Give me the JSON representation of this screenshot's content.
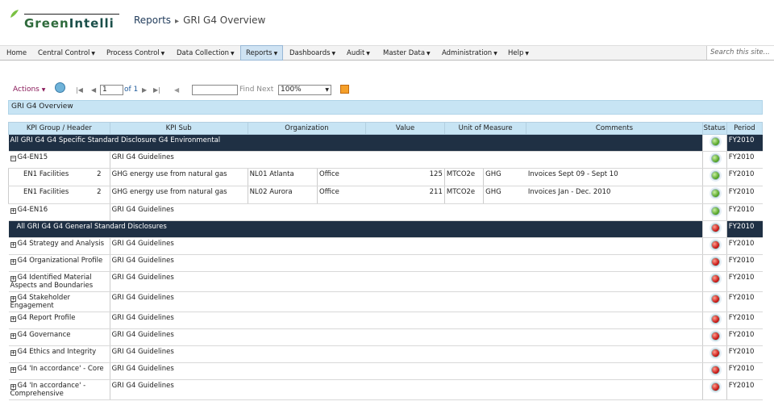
{
  "brand": {
    "name_prefix": "Green",
    "name_suffix": "Intelli"
  },
  "breadcrumb": {
    "root": "Reports",
    "current": "GRI G4 Overview"
  },
  "nav": {
    "items": [
      "Home",
      "Central Control",
      "Process Control",
      "Data Collection",
      "Reports",
      "Dashboards",
      "Audit",
      "Master Data",
      "Administration",
      "Help"
    ],
    "search_placeholder": "Search this site..."
  },
  "toolbar": {
    "actions_label": "Actions",
    "page_value": "1",
    "page_of": "of 1",
    "find_next": "Find Next",
    "zoom": "100%"
  },
  "report_title": "GRI G4 Overview",
  "columns": [
    "KPI Group / Header",
    "KPI Sub",
    "Organization",
    "Value",
    "Unit of Measure",
    "Comments",
    "Status",
    "Period"
  ],
  "rows": {
    "g1_label": "All GRI G4   G4 Specific Standard Disclosure   G4 Environmental",
    "g1_period": "FY2010",
    "en15": {
      "label": "G4-EN15",
      "sub": "GRI G4 Guidelines",
      "period": "FY2010"
    },
    "d1": {
      "kpi": "EN1 Facilities",
      "num": "2",
      "sub": "GHG energy use from natural gas",
      "org": "NL01 Atlanta",
      "type": "Office",
      "value": "125",
      "unit": "MTCO2e",
      "cat": "GHG",
      "comment": "Invoices Sept 09 - Sept 10",
      "period": "FY2010"
    },
    "d2": {
      "kpi": "EN1 Facilities",
      "num": "2",
      "sub": "GHG energy use from natural gas",
      "org": "NL02 Aurora",
      "type": "Office",
      "value": "211",
      "unit": "MTCO2e",
      "cat": "GHG",
      "comment": "Invoices Jan - Dec. 2010",
      "period": "FY2010"
    },
    "en16": {
      "label": "G4-EN16",
      "sub": "GRI G4 Guidelines",
      "period": "FY2010"
    },
    "g2_label": "All GRI G4   G4 General Standard Disclosures",
    "g2_period": "FY2010",
    "r1": {
      "label": "G4 Strategy and Analysis",
      "sub": "GRI G4 Guidelines",
      "period": "FY2010"
    },
    "r2": {
      "label": "G4 Organizational Profile",
      "sub": "GRI G4 Guidelines",
      "period": "FY2010"
    },
    "r3": {
      "label1": "G4 Identified Material",
      "label2": "Aspects and Boundaries",
      "sub": "GRI G4 Guidelines",
      "period": "FY2010"
    },
    "r4": {
      "label1": "G4 Stakeholder",
      "label2": "Engagement",
      "sub": "GRI G4 Guidelines",
      "period": "FY2010"
    },
    "r5": {
      "label": "G4 Report Profile",
      "sub": "GRI G4 Guidelines",
      "period": "FY2010"
    },
    "r6": {
      "label": "G4 Governance",
      "sub": "GRI G4 Guidelines",
      "period": "FY2010"
    },
    "r7": {
      "label": "G4 Ethics and Integrity",
      "sub": "GRI G4 Guidelines",
      "period": "FY2010"
    },
    "r8": {
      "label": "G4 'In accordance' - Core",
      "sub": "GRI G4 Guidelines",
      "period": "FY2010"
    },
    "r9": {
      "label1": "G4 'In accordance' -",
      "label2": "Comprehensive",
      "sub": "GRI G4 Guidelines",
      "period": "FY2010"
    }
  },
  "status_colors": {
    "ok": "#4b9e1c",
    "alert": "#c20b0b"
  }
}
